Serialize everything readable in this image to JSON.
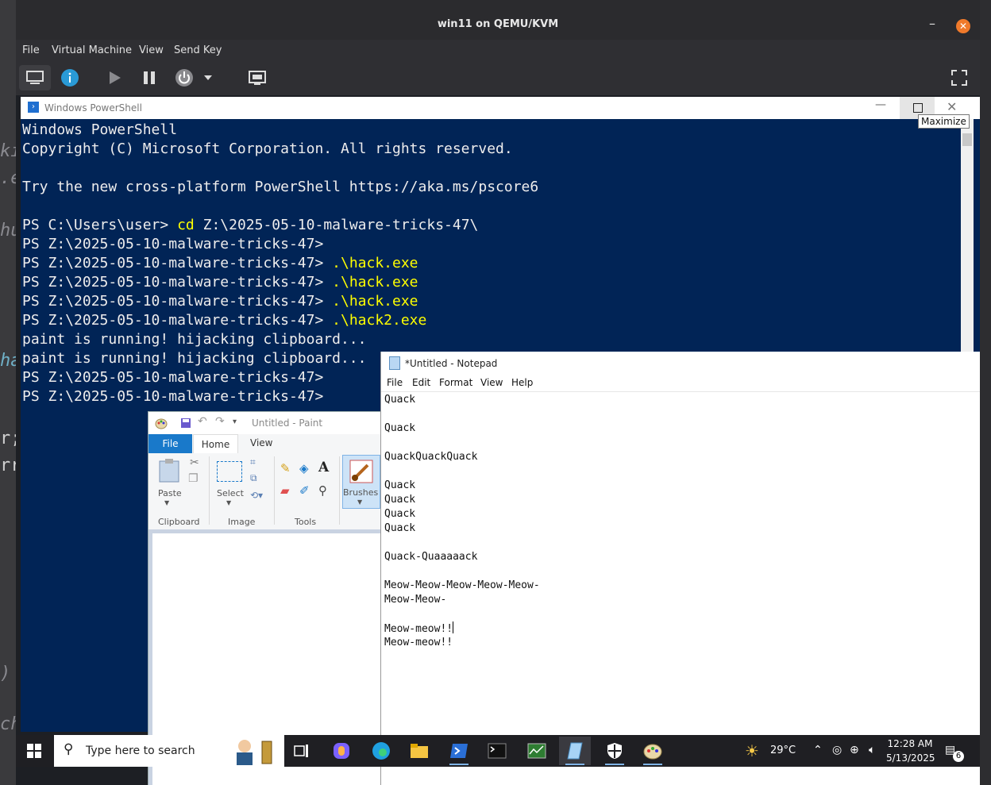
{
  "host": {
    "fragments": [
      "ki",
      ".e",
      "hu",
      "ha",
      "r;",
      "rr",
      ")",
      "ch"
    ]
  },
  "vm": {
    "title": "win11 on QEMU/KVM",
    "menu": [
      "File",
      "Virtual Machine",
      "View",
      "Send Key"
    ]
  },
  "powershell": {
    "title": "Windows PowerShell",
    "tooltip": "Maximize",
    "lines": [
      {
        "prompt": "Windows PowerShell",
        "cmd": ""
      },
      {
        "prompt": "Copyright (C) Microsoft Corporation. All rights reserved.",
        "cmd": ""
      },
      {
        "prompt": "",
        "cmd": ""
      },
      {
        "prompt": "Try the new cross-platform PowerShell https://aka.ms/pscore6",
        "cmd": ""
      },
      {
        "prompt": "",
        "cmd": ""
      },
      {
        "prompt": "PS C:\\Users\\user> ",
        "cmd": "cd",
        "rest": " Z:\\2025-05-10-malware-tricks-47\\"
      },
      {
        "prompt": "PS Z:\\2025-05-10-malware-tricks-47>",
        "cmd": ""
      },
      {
        "prompt": "PS Z:\\2025-05-10-malware-tricks-47> ",
        "cmd": ".\\hack.exe"
      },
      {
        "prompt": "PS Z:\\2025-05-10-malware-tricks-47> ",
        "cmd": ".\\hack.exe"
      },
      {
        "prompt": "PS Z:\\2025-05-10-malware-tricks-47> ",
        "cmd": ".\\hack.exe"
      },
      {
        "prompt": "PS Z:\\2025-05-10-malware-tricks-47> ",
        "cmd": ".\\hack2.exe"
      },
      {
        "prompt": "paint is running! hijacking clipboard...",
        "cmd": ""
      },
      {
        "prompt": "paint is running! hijacking clipboard...",
        "cmd": ""
      },
      {
        "prompt": "PS Z:\\2025-05-10-malware-tricks-47>",
        "cmd": ""
      },
      {
        "prompt": "PS Z:\\2025-05-10-malware-tricks-47>",
        "cmd": ""
      }
    ]
  },
  "paint": {
    "title": "Untitled - Paint",
    "tabs": {
      "file": "File",
      "home": "Home",
      "view": "View"
    },
    "labels": {
      "paste": "Paste",
      "select": "Select",
      "brushes": "Brushes"
    },
    "groups": {
      "clipboard": "Clipboard",
      "image": "Image",
      "tools": "Tools"
    }
  },
  "notepad": {
    "title": "*Untitled - Notepad",
    "menu": [
      "File",
      "Edit",
      "Format",
      "View",
      "Help"
    ],
    "lines": [
      "Quack",
      "",
      "Quack",
      "",
      "QuackQuackQuack",
      "",
      "Quack",
      "Quack",
      "Quack",
      "Quack",
      "",
      "Quack-Quaaaaack",
      "",
      "Meow-Meow-Meow-Meow-Meow-",
      "Meow-Meow-",
      "",
      "Meow-meow!!",
      "Meow-meow!!"
    ],
    "caret_line": 16
  },
  "taskbar": {
    "search_placeholder": "Type here to search",
    "temperature": "29°C",
    "time": "12:28 AM",
    "date": "5/13/2025",
    "notification_count": "6"
  }
}
